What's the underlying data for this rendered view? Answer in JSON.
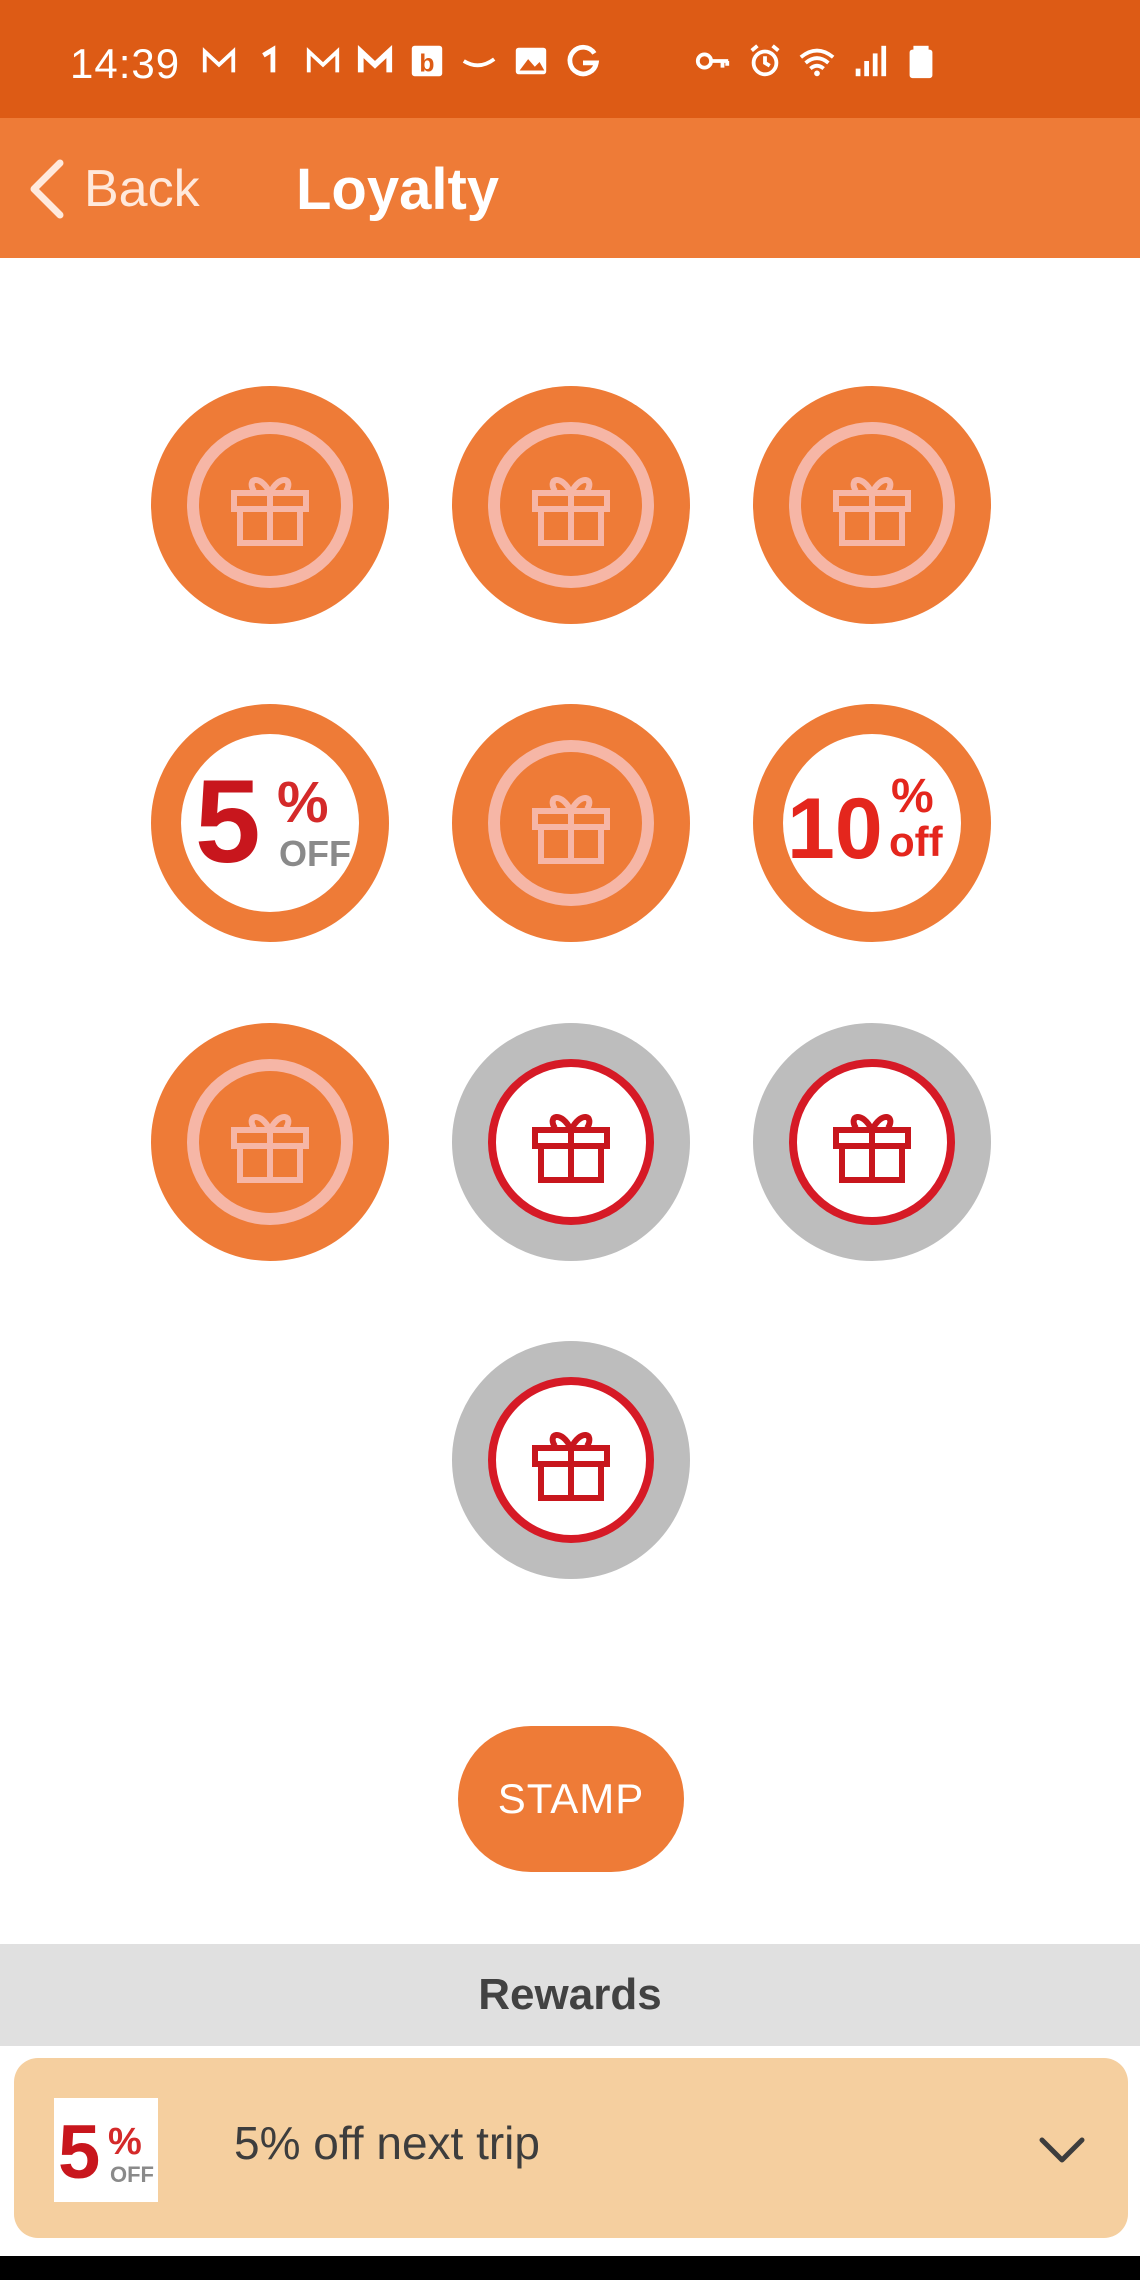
{
  "status_bar": {
    "time": "14:39",
    "left_icons": [
      "gmail-icon",
      "notification-1-icon",
      "gmail-icon",
      "gmail-icon",
      "booking-b-icon",
      "amazon-icon",
      "gallery-icon",
      "google-g-icon"
    ],
    "right_icons": [
      "vpn-key-icon",
      "alarm-icon",
      "wifi-icon",
      "signal-icon",
      "battery-icon"
    ],
    "background": "#dd5b15"
  },
  "app_bar": {
    "back_label": "Back",
    "title": "Loyalty",
    "background": "#ee7b37"
  },
  "stamp_card": {
    "stamps": [
      {
        "state": "collected",
        "icon": "gift-icon"
      },
      {
        "state": "collected",
        "icon": "gift-icon"
      },
      {
        "state": "collected",
        "icon": "gift-icon"
      },
      {
        "state": "reward",
        "badge": "5% OFF"
      },
      {
        "state": "collected",
        "icon": "gift-icon"
      },
      {
        "state": "reward",
        "badge": "10% off"
      },
      {
        "state": "collected",
        "icon": "gift-icon"
      },
      {
        "state": "empty",
        "icon": "gift-icon"
      },
      {
        "state": "empty",
        "icon": "gift-icon"
      },
      {
        "state": "empty",
        "icon": "gift-icon"
      }
    ],
    "colors": {
      "collected": "#ee7b37",
      "empty": "#bdbdbd",
      "empty_ring": "#d61a26",
      "collected_ring": "#f6b6a6"
    }
  },
  "badges": {
    "five_num": "5",
    "five_pct": "%",
    "five_off": "OFF",
    "ten_num": "10",
    "ten_pct": "%",
    "ten_off": "off"
  },
  "stamp_button": {
    "label": "STAMP"
  },
  "rewards": {
    "header": "Rewards",
    "items": [
      {
        "label": "5% off next trip",
        "thumb_num": "5",
        "thumb_pct": "%",
        "thumb_off": "OFF",
        "background": "#f5cf9f"
      }
    ]
  }
}
